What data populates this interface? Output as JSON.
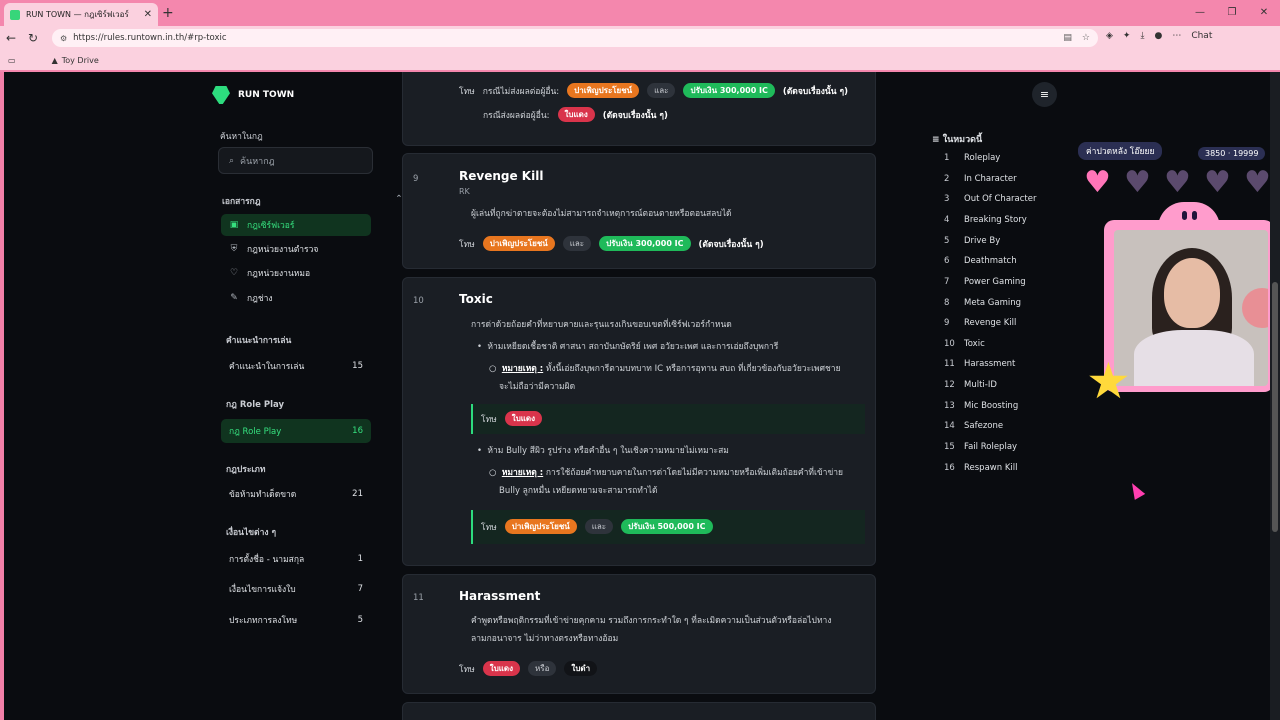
{
  "browser": {
    "tab_title": "RUN TOWN — กฎเซิร์ฟเวอร์",
    "url": "https://rules.runtown.in.th/#rp-toxic",
    "bookmark": "Toy Drive",
    "chat_label": "Chat"
  },
  "sidebar": {
    "brand": "RUN TOWN",
    "search_label": "ค้นหาในกฎ",
    "search_placeholder": "ค้นหากฎ",
    "doc_section": "เอกสารกฎ",
    "doc_items": [
      {
        "label": "กฎเซิร์ฟเวอร์",
        "icon": "book-icon"
      },
      {
        "label": "กฎหน่วยงานตำรวจ",
        "icon": "shield-icon"
      },
      {
        "label": "กฎหน่วยงานหมอ",
        "icon": "heart-icon"
      },
      {
        "label": "กฎช่าง",
        "icon": "wrench-icon"
      }
    ],
    "groups": [
      {
        "title": "คำแนะนำการเล่น",
        "items": [
          {
            "label": "คำแนะนำในการเล่น",
            "count": "15"
          }
        ]
      },
      {
        "title": "กฎ Role Play",
        "items": [
          {
            "label": "กฎ Role Play",
            "count": "16"
          }
        ]
      },
      {
        "title": "กฎประเภท",
        "items": [
          {
            "label": "ข้อห้ามทำเด็ดขาด",
            "count": "21"
          }
        ]
      },
      {
        "title": "เงื่อนไขต่าง ๆ",
        "items": [
          {
            "label": "การตั้งชื่อ - นามสกุล",
            "count": "1"
          },
          {
            "label": "เงื่อนไขการแจ้งใบ",
            "count": "7"
          },
          {
            "label": "ประเภทการลงโทษ",
            "count": "5"
          }
        ]
      }
    ]
  },
  "content": {
    "top_partial": {
      "penalty_label": "โทษ",
      "line1_prefix": "กรณีไม่ส่งผลต่อผู้อื่น:",
      "line1_pill1": "ปาเพิญประโยชน์",
      "line1_and": "และ",
      "line1_pill2": "ปรับเงิน 300,000 IC",
      "line1_suffix": "(ตัดจบเรื่องนั้น ๆ)",
      "line2_prefix": "กรณีส่งผลต่อผู้อื่น:",
      "line2_pill": "ใบแดง",
      "line2_suffix": "(ตัดจบเรื่องนั้น ๆ)"
    },
    "rule9": {
      "num": "9",
      "title": "Revenge Kill",
      "code": "RK",
      "desc": "ผู้เล่นที่ถูกฆ่าตายจะต้องไม่สามารถจำเหตุการณ์ตอนตายหรือตอนสลบได้",
      "penalty_label": "โทษ",
      "pill1": "ปาเพิญประโยชน์",
      "and": "และ",
      "pill2": "ปรับเงิน 300,000 IC",
      "suffix": "(ตัดจบเรื่องนั้น ๆ)"
    },
    "rule10": {
      "num": "10",
      "title": "Toxic",
      "desc": "การด่าด้วยถ้อยคำที่หยาบคายและรุนแรงเกินขอบเขตที่เซิร์ฟเวอร์กำหนด",
      "b1": "ห้ามเหยียดเชื้อชาติ ศาสนา สถาบันกษัตริย์ เพศ อวัยวะเพศ และการเอ่ยถึงบุพการี",
      "note_label": "หมายเหตุ :",
      "note1a": "ทั้งนี้เอ่ยถึงบุพการีตามบทบาท IC หรือการอุทาน สบถ ที่เกี่ยวข้องกับอวัยวะเพศชาย",
      "note1b": "จะไม่ถือว่ามีความผิด",
      "p1_label": "โทษ",
      "p1_pill": "ใบแดง",
      "b2": "ห้าม Bully สีผิว รูปร่าง หรือคำอื่น ๆ ในเชิงความหมายไม่เหมาะสม",
      "note2a": "การใช้ถ้อยคำหยาบคายในการด่าโดยไม่มีความหมายหรือเพิ่มเติมถ้อยคำที่เข้าข่าย",
      "note2b": "Bully ลูกหมื่น เหยียดหยามจะสามารถทำได้",
      "p2_label": "โทษ",
      "p2_pill1": "ปาเพิญประโยชน์",
      "p2_and": "และ",
      "p2_pill2": "ปรับเงิน 500,000 IC"
    },
    "rule11": {
      "num": "11",
      "title": "Harassment",
      "desc1": "คำพูดหรือพฤติกรรมที่เข้าข่ายคุกคาม รวมถึงการกระทำใด ๆ ที่ละเมิดความเป็นส่วนตัวหรือล่อไปทาง",
      "desc2": "ลามกอนาจาร ไม่ว่าทางตรงหรือทางอ้อม",
      "penalty_label": "โทษ",
      "pill1": "ใบแดง",
      "or": "หรือ",
      "pill2": "ใบดำ"
    }
  },
  "toc": {
    "heading": "ในหมวดนี้",
    "items": [
      {
        "n": "1",
        "label": "Roleplay"
      },
      {
        "n": "2",
        "label": "In Character"
      },
      {
        "n": "3",
        "label": "Out Of Character"
      },
      {
        "n": "4",
        "label": "Breaking Story"
      },
      {
        "n": "5",
        "label": "Drive By"
      },
      {
        "n": "6",
        "label": "Deathmatch"
      },
      {
        "n": "7",
        "label": "Power Gaming"
      },
      {
        "n": "8",
        "label": "Meta Gaming"
      },
      {
        "n": "9",
        "label": "Revenge Kill"
      },
      {
        "n": "10",
        "label": "Toxic"
      },
      {
        "n": "11",
        "label": "Harassment"
      },
      {
        "n": "12",
        "label": "Multi-ID"
      },
      {
        "n": "13",
        "label": "Mic Boosting"
      },
      {
        "n": "14",
        "label": "Safezone"
      },
      {
        "n": "15",
        "label": "Fail Roleplay"
      },
      {
        "n": "16",
        "label": "Respawn Kill"
      }
    ]
  },
  "stream_overlay": {
    "label": "ค่าปวดหลัง โอ๊ยยย",
    "score": "3850 · 19999",
    "hearts_filled": 1,
    "hearts_total": 5
  },
  "colors": {
    "accent": "#36e07f",
    "orange": "#e8761f",
    "green": "#1fba5a",
    "red": "#d9344b",
    "browser_pink": "#f487ad"
  }
}
